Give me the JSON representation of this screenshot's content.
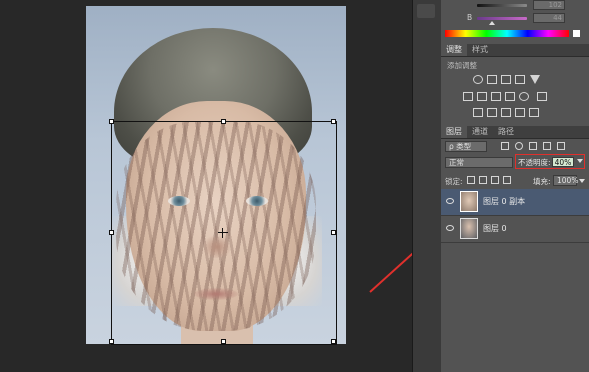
{
  "color_panel": {
    "b_label": "B",
    "value_top": "102",
    "value_b": "44"
  },
  "adjustments": {
    "tabs": [
      "调整",
      "样式"
    ],
    "title": "添加调整"
  },
  "layers_panel": {
    "tabs": [
      "图层",
      "通道",
      "路径"
    ],
    "kind_label": "ρ 类型",
    "blend_mode": "正常",
    "opacity_label": "不透明度:",
    "opacity_value": "40%",
    "lock_label": "锁定:",
    "fill_label": "填充:",
    "fill_value": "100%",
    "layers": [
      {
        "name": "图层 0 副本",
        "selected": true
      },
      {
        "name": "图层 0",
        "selected": false
      }
    ]
  },
  "colors": {
    "highlight_red": "#e0302c",
    "selected_layer": "#4a5a72",
    "opacity_value_bg": "#d6e9d2"
  },
  "icons": [
    "eye-icon",
    "brightness-icon",
    "levels-icon",
    "curves-icon",
    "exposure-icon",
    "vibrance-icon",
    "hue-saturation-icon",
    "color-balance-icon",
    "black-white-icon",
    "photo-filter-icon",
    "channel-mixer-icon",
    "color-lookup-icon",
    "invert-icon",
    "posterize-icon",
    "threshold-icon",
    "gradient-map-icon",
    "selective-color-icon"
  ]
}
